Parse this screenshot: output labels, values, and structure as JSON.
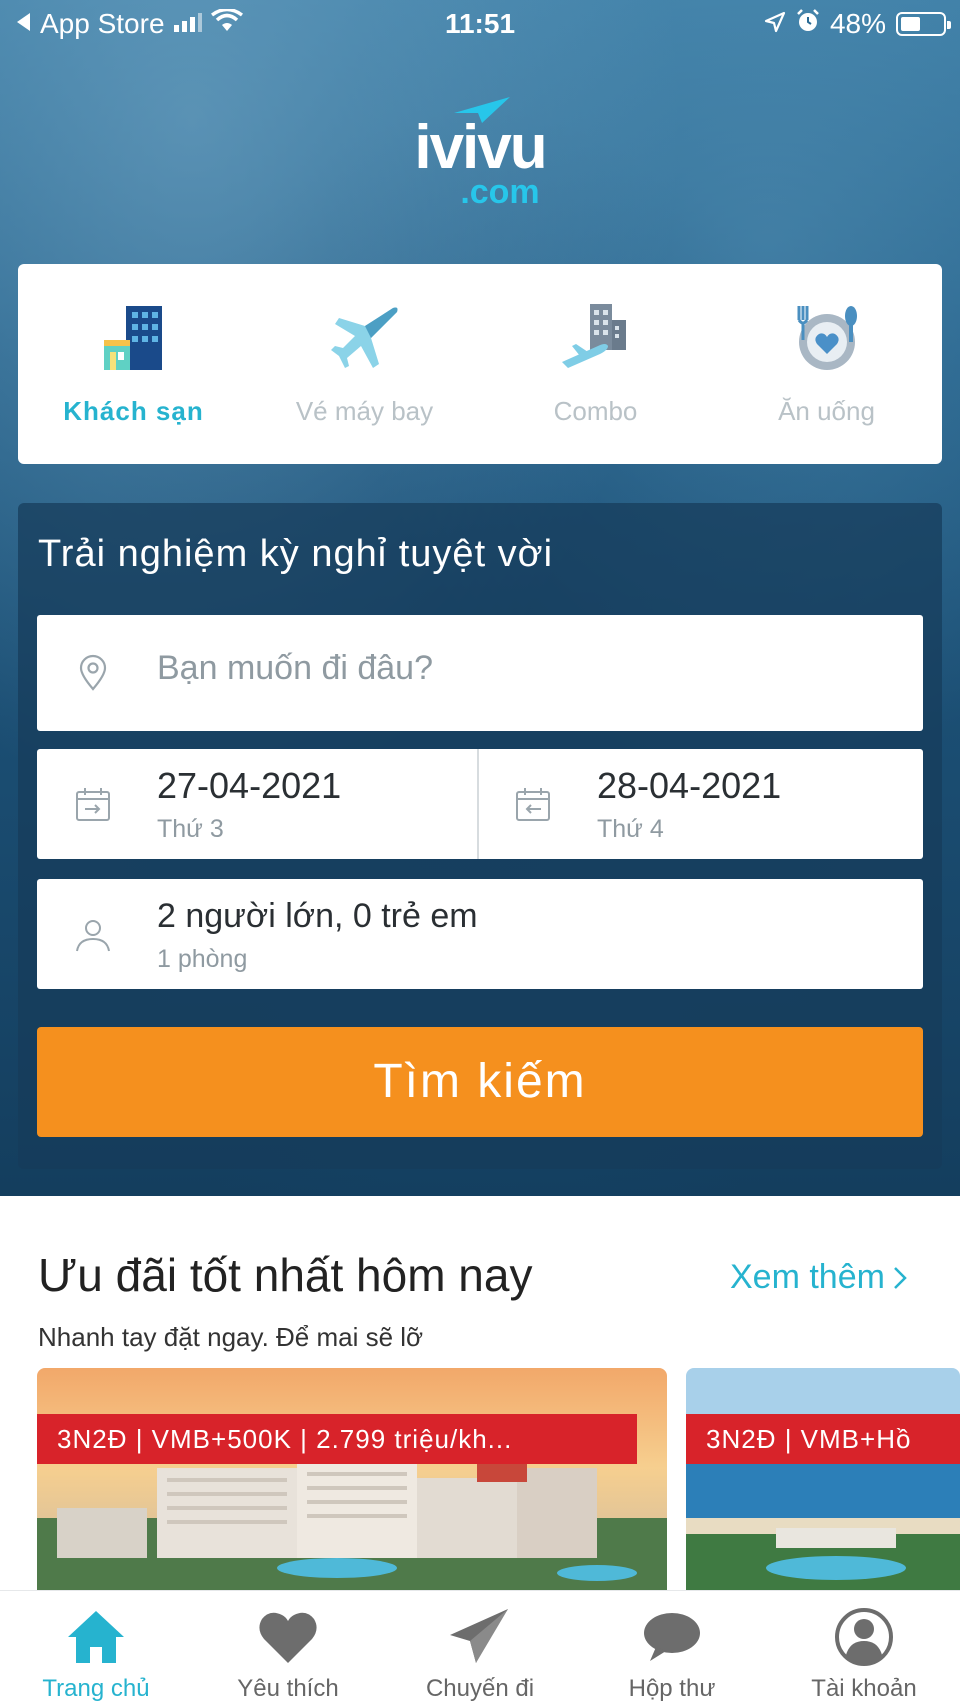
{
  "status_bar": {
    "back_app": "App Store",
    "time": "11:51",
    "battery": "48%",
    "battery_level": 0.48
  },
  "logo": {
    "main": "ivivu",
    "sub": ".com"
  },
  "categories": [
    {
      "label": "Khách sạn",
      "icon": "hotel-icon",
      "active": true
    },
    {
      "label": "Vé máy bay",
      "icon": "airplane-icon",
      "active": false
    },
    {
      "label": "Combo",
      "icon": "combo-icon",
      "active": false
    },
    {
      "label": "Ăn uống",
      "icon": "dining-icon",
      "active": false
    }
  ],
  "search": {
    "title": "Trải nghiệm kỳ nghỉ tuyệt vời",
    "destination_placeholder": "Bạn muốn đi đâu?",
    "checkin_date": "27-04-2021",
    "checkin_day": "Thứ 3",
    "checkout_date": "28-04-2021",
    "checkout_day": "Thứ 4",
    "guests": "2 người lớn, 0 trẻ em",
    "rooms": "1 phòng",
    "button": "Tìm kiếm"
  },
  "deals": {
    "title": "Ưu đãi tốt nhất hôm nay",
    "more": "Xem thêm",
    "subtitle": "Nhanh tay đặt ngay. Để mai sẽ lỡ",
    "items": [
      {
        "tag": "3N2Đ | VMB+500K | 2.799 triệu/kh..."
      },
      {
        "tag": "3N2Đ | VMB+Hồ"
      }
    ]
  },
  "bottom_nav": [
    {
      "label": "Trang chủ",
      "icon": "home-icon",
      "active": true
    },
    {
      "label": "Yêu thích",
      "icon": "heart-icon",
      "active": false
    },
    {
      "label": "Chuyến đi",
      "icon": "paper-plane-icon",
      "active": false
    },
    {
      "label": "Hộp thư",
      "icon": "chat-bubble-icon",
      "active": false
    },
    {
      "label": "Tài khoản",
      "icon": "account-icon",
      "active": false
    }
  ],
  "colors": {
    "accent": "#26b3cf",
    "search_button": "#f5901e",
    "deal_tag": "#d8232a"
  }
}
